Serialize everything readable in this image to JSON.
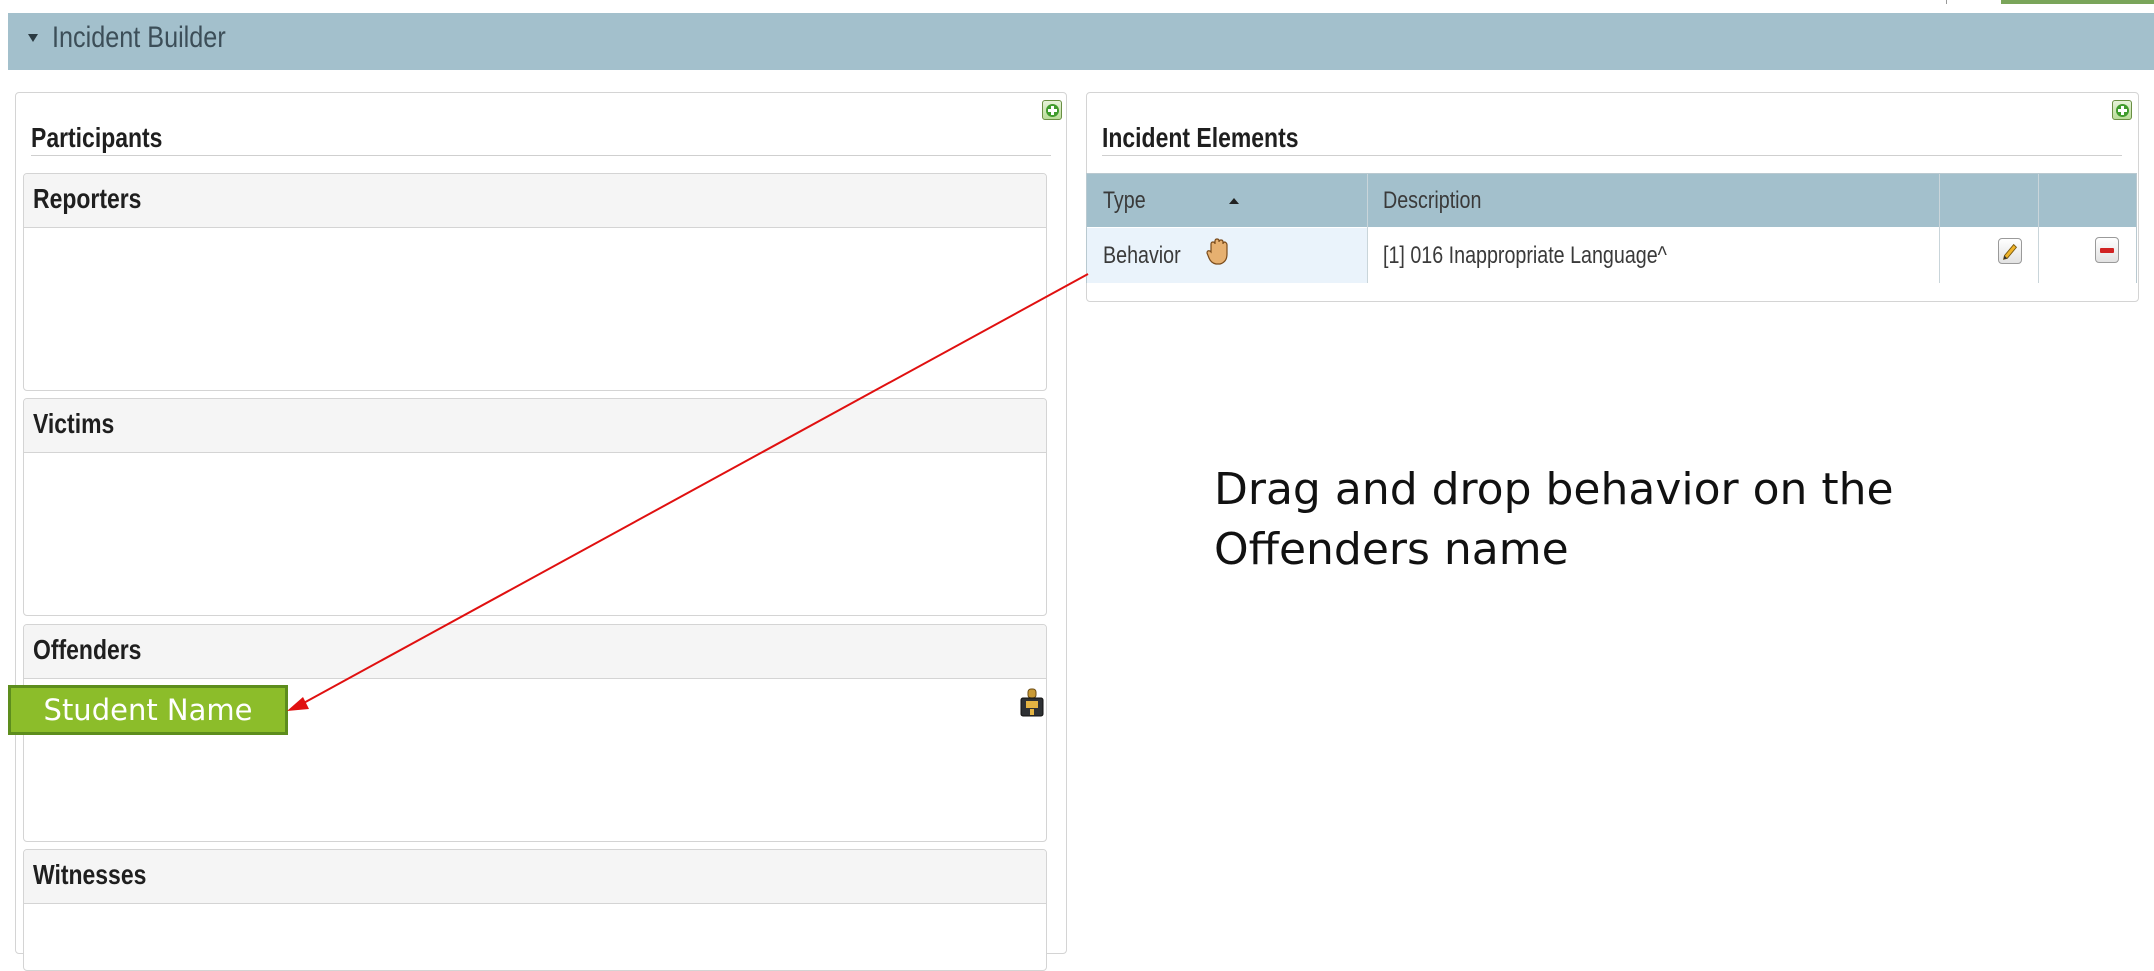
{
  "header": {
    "title": "Incident Builder"
  },
  "participants": {
    "title": "Participants",
    "sections": [
      {
        "title": "Reporters"
      },
      {
        "title": "Victims"
      },
      {
        "title": "Offenders"
      },
      {
        "title": "Witnesses"
      }
    ]
  },
  "incident_elements": {
    "title": "Incident Elements",
    "columns": [
      "Type",
      "Description"
    ],
    "rows": [
      {
        "type": "Behavior",
        "description": "[1] 016 Inappropriate Language^"
      }
    ]
  },
  "drag_item": {
    "label": "Student Name"
  },
  "annotation": {
    "line1": "Drag and drop behavior on the",
    "line2": "Offenders name",
    "arrow_color": "#e01010"
  },
  "colors": {
    "header_bg": "#a3c0cc",
    "drag_label_bg": "#8cbd2a",
    "add_icon": "#3f9b2c",
    "delete_icon": "#d12323"
  },
  "icons": {
    "header_toggle": "caret-down-icon",
    "add": "add-icon",
    "drag_handle": "hand-icon",
    "edit": "pencil-icon",
    "delete": "minus-icon",
    "offender_tool": "package-icon"
  }
}
